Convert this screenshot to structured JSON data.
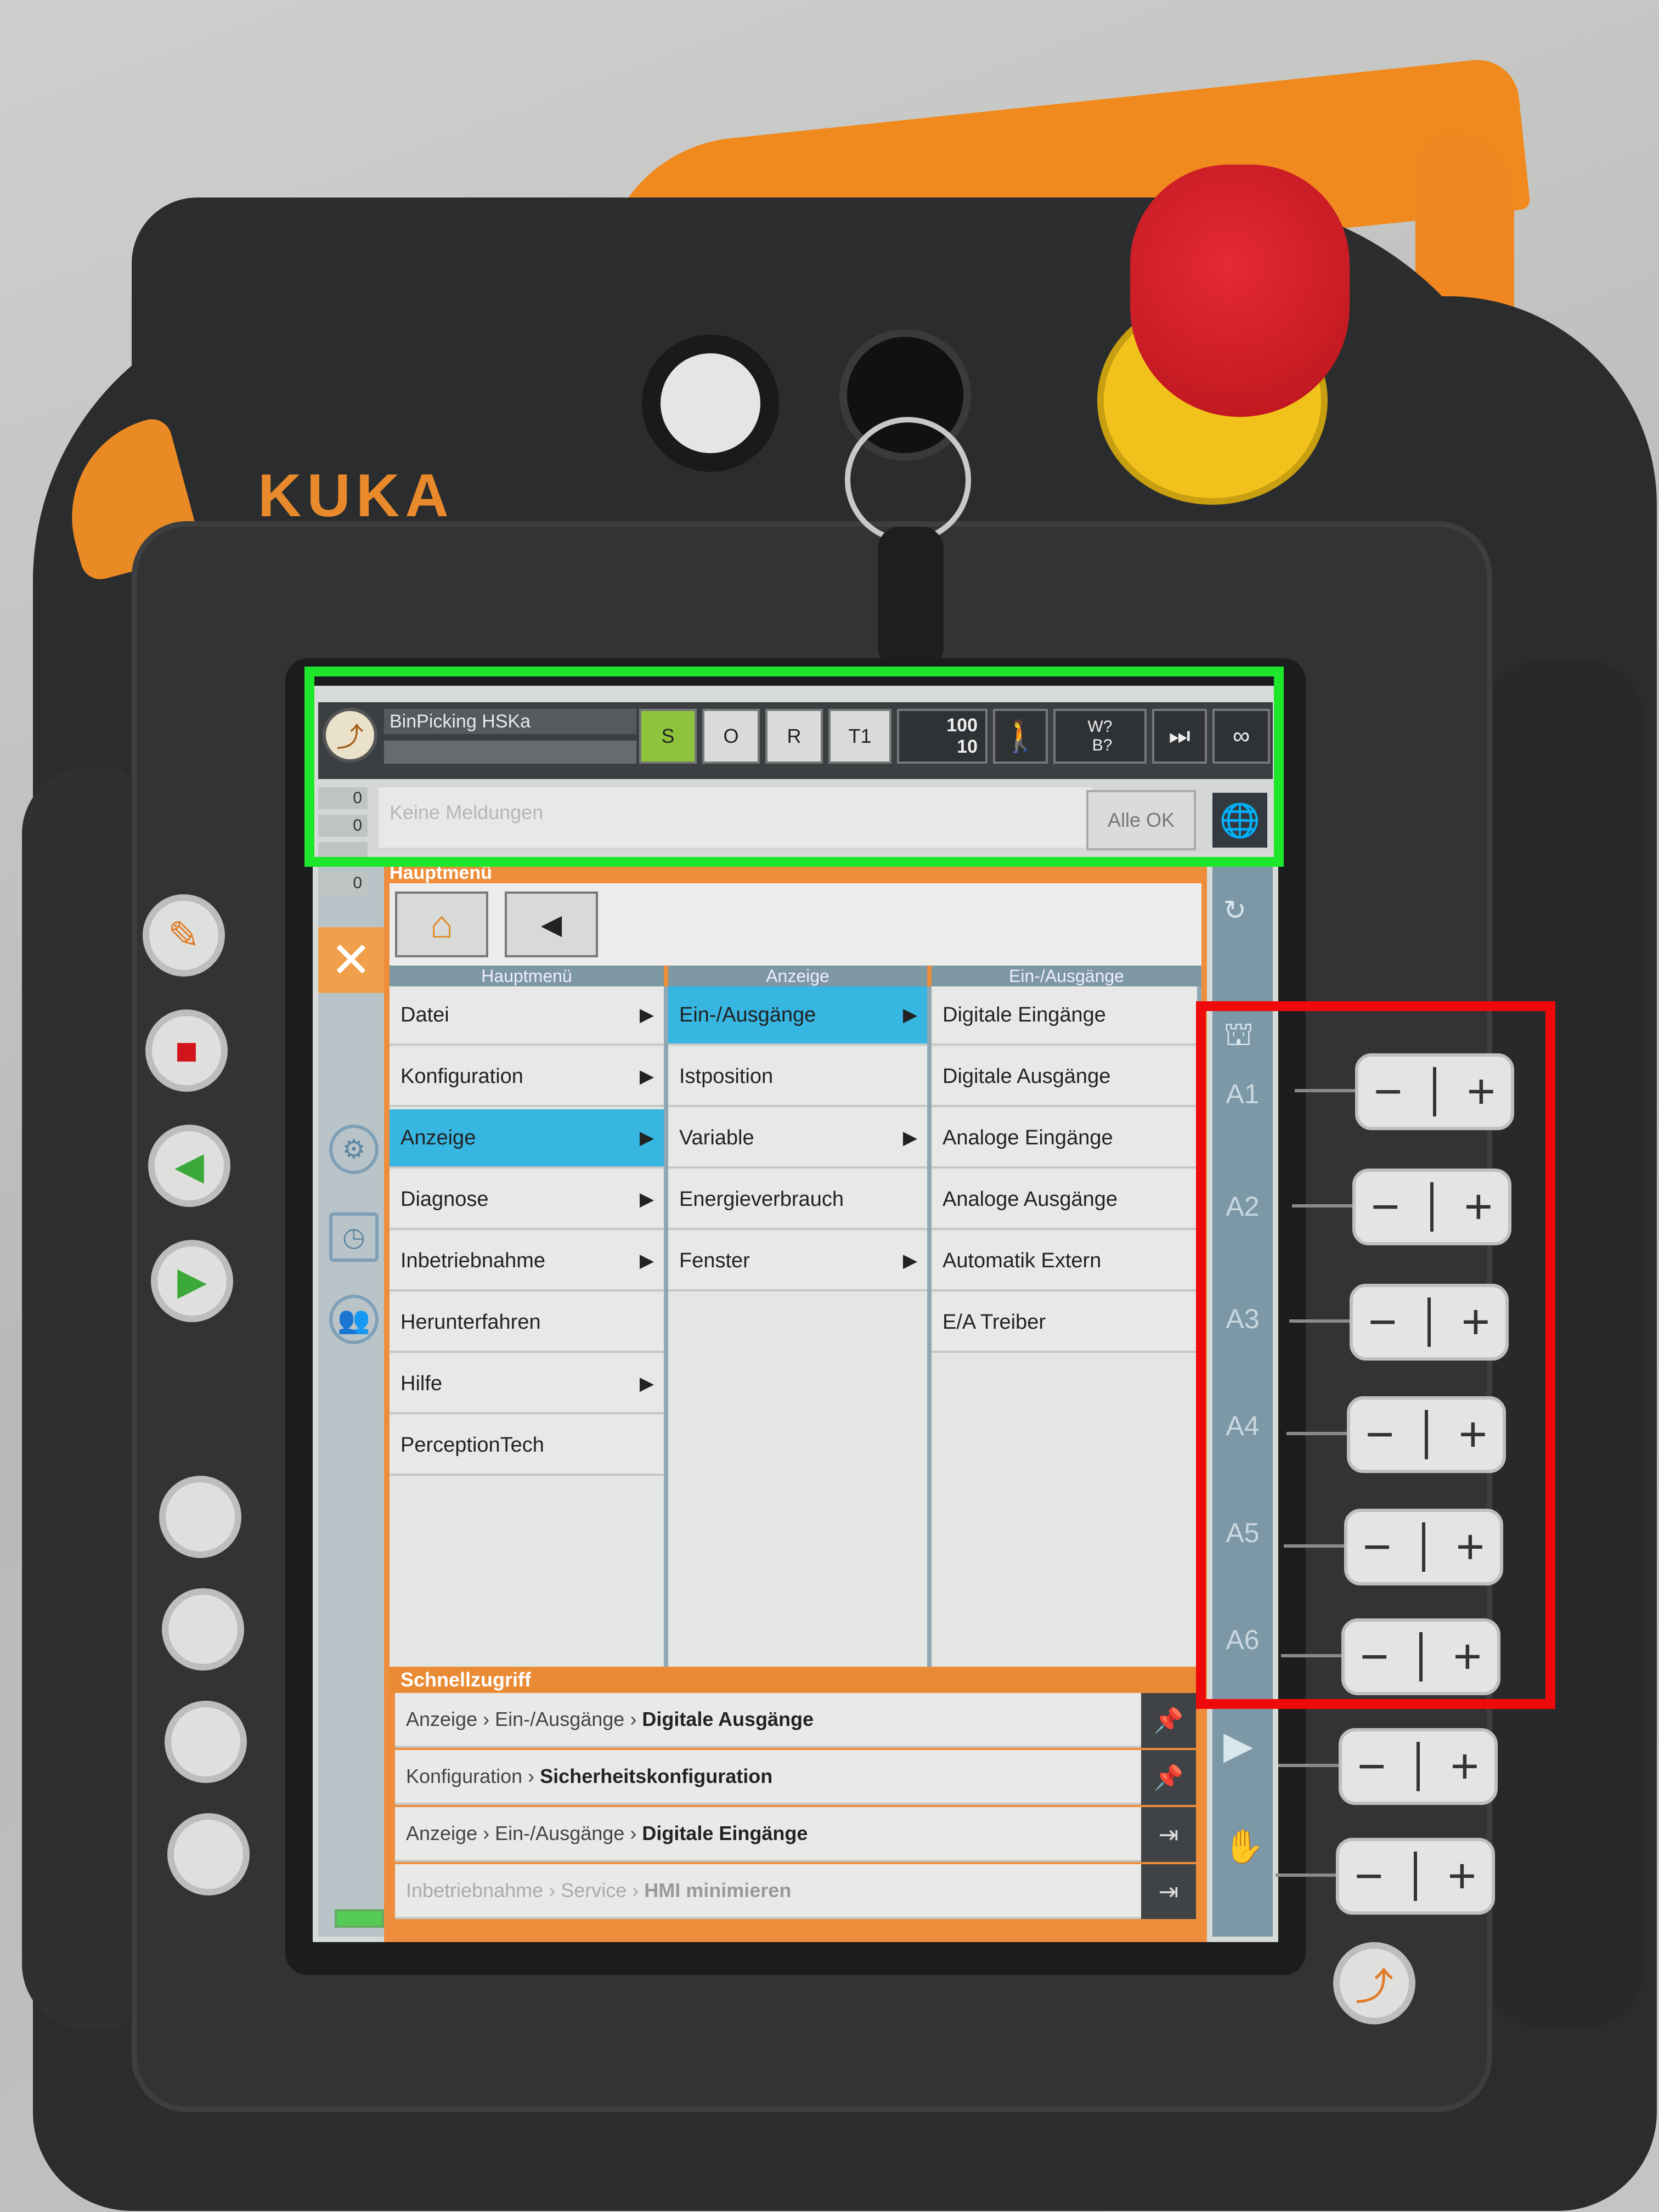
{
  "device": {
    "brand": "KUKA"
  },
  "status_bar": {
    "project": "BinPicking HSKa",
    "submit_state": "S",
    "drive_state": "O",
    "robot_interpreter": "R",
    "mode": "T1",
    "override_prog": "100",
    "override_jog": "10",
    "tool_base": "W?\nB?",
    "infinity": "∞"
  },
  "messages": {
    "counters": [
      "0",
      "0",
      "0",
      "0"
    ],
    "placeholder": "Keine Meldungen",
    "ack_button": "Alle OK"
  },
  "main_menu": {
    "title": "Hauptmenü",
    "columns": [
      {
        "header": "Hauptmenü",
        "items": [
          {
            "label": "Datei",
            "arrow": "▶"
          },
          {
            "label": "Konfiguration",
            "arrow": "▶"
          },
          {
            "label": "Anzeige",
            "arrow": "▶"
          },
          {
            "label": "Diagnose",
            "arrow": "▶"
          },
          {
            "label": "Inbetriebnahme",
            "arrow": "▶"
          },
          {
            "label": "Herunterfahren",
            "arrow": ""
          },
          {
            "label": "Hilfe",
            "arrow": "▶"
          },
          {
            "label": "PerceptionTech",
            "arrow": ""
          }
        ]
      },
      {
        "header": "Anzeige",
        "items": [
          {
            "label": "Ein-/Ausgänge",
            "arrow": "▶"
          },
          {
            "label": "Istposition",
            "arrow": ""
          },
          {
            "label": "Variable",
            "arrow": "▶"
          },
          {
            "label": "Energieverbrauch",
            "arrow": ""
          },
          {
            "label": "Fenster",
            "arrow": "▶"
          }
        ]
      },
      {
        "header": "Ein-/Ausgänge",
        "items": [
          {
            "label": "Digitale Eingänge"
          },
          {
            "label": "Digitale Ausgänge"
          },
          {
            "label": "Analoge Eingänge"
          },
          {
            "label": "Analoge Ausgänge"
          },
          {
            "label": "Automatik Extern"
          },
          {
            "label": "E/A Treiber"
          }
        ]
      }
    ]
  },
  "quick_access": {
    "title": "Schnellzugriff",
    "sep": "›",
    "rows": [
      {
        "path1": "Anzeige",
        "path2": "Ein-/Ausgänge",
        "target": "Digitale Ausgänge"
      },
      {
        "path1": "Konfiguration",
        "path2": "",
        "target": "Sicherheitskonfiguration"
      },
      {
        "path1": "Anzeige",
        "path2": "Ein-/Ausgänge",
        "target": "Digitale Eingänge"
      },
      {
        "path1": "Inbetriebnahme",
        "path2": "Service",
        "target": "HMI minimieren"
      }
    ]
  },
  "jog_axes": [
    "A1",
    "A2",
    "A3",
    "A4",
    "A5",
    "A6"
  ],
  "jog_keys": {
    "minus": "−",
    "plus": "+"
  },
  "colors": {
    "highlight_green": "#1ee62b",
    "highlight_red": "#ee0a0a",
    "selection": "#37b6e2",
    "kuka_orange": "#f08a1e"
  }
}
